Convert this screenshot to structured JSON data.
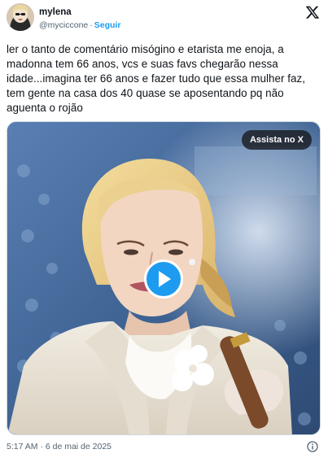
{
  "author": {
    "display_name": "mylena",
    "handle": "@myciccone",
    "separator": "·",
    "follow_label": "Seguir",
    "avatar_icon": "avatar-photo"
  },
  "tweet": {
    "text": "ler o tanto de comentário misógino e etarista me enoja, a madonna tem 66 anos, vcs e suas favs chegarão nessa idade...imagina ter 66 anos e fazer tudo que essa mulher faz, tem gente na casa dos 40 quase se aposentando pq não aguenta o rojão",
    "timestamp": "5:17 AM · 6 de mai de 2025"
  },
  "media": {
    "watch_label": "Assista no X",
    "play_icon": "play-icon",
    "kind": "video"
  },
  "icons": {
    "x_logo": "x-logo-icon",
    "info": "info-icon"
  },
  "colors": {
    "accent": "#1d9bf0",
    "text": "#0f1419",
    "secondary": "#536471",
    "border": "#cfd9de"
  }
}
